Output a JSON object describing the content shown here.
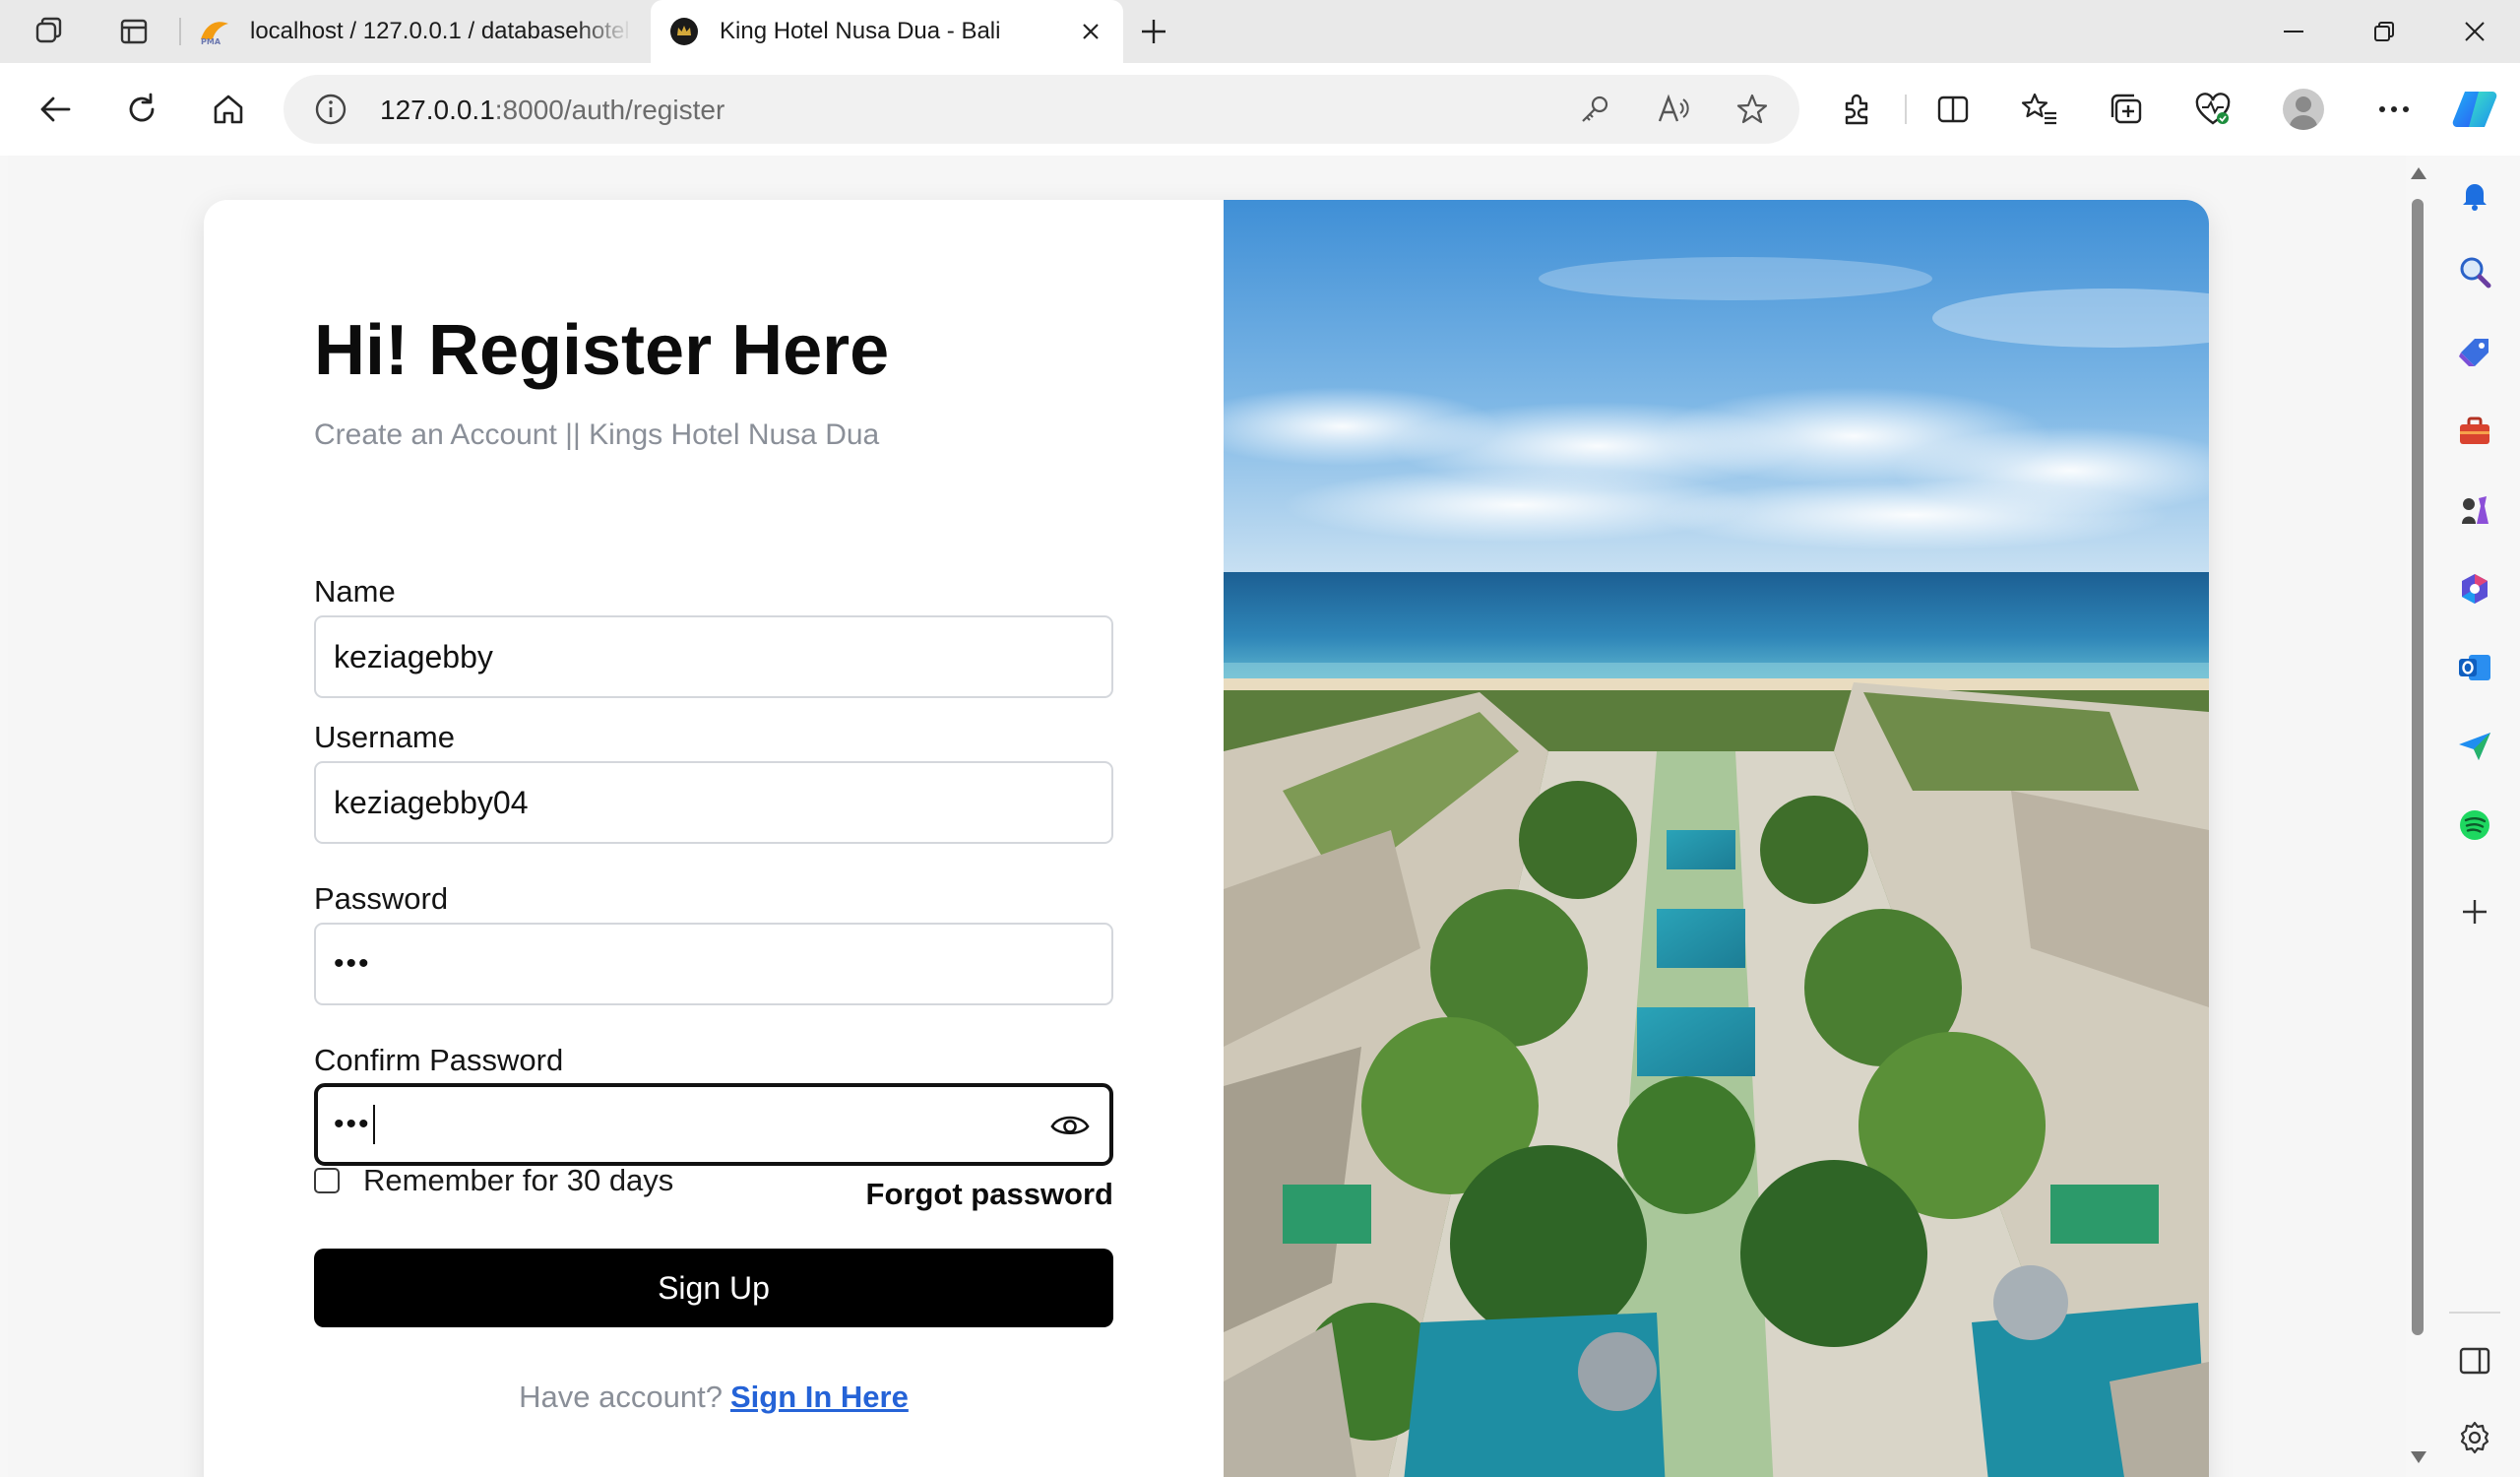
{
  "browser": {
    "tabs": [
      {
        "title": "localhost / 127.0.0.1 / databasehotel",
        "favicon": "phpmyadmin-icon",
        "active": false
      },
      {
        "title": "King Hotel Nusa Dua - Bali",
        "favicon": "crown-icon",
        "active": true
      }
    ],
    "url_host": "127.0.0.1",
    "url_rest": ":8000/auth/register"
  },
  "form": {
    "heading": "Hi! Register Here",
    "subheading": "Create an Account || Kings Hotel Nusa Dua",
    "fields": [
      {
        "label": "Name",
        "value": "keziagebby"
      },
      {
        "label": "Username",
        "value": "keziagebby04"
      },
      {
        "label": "Password",
        "value": "•••"
      },
      {
        "label": "Confirm Password",
        "value": "•••"
      }
    ],
    "remember_label": "Remember for 30 days",
    "remember_checked": false,
    "forgot_label": "Forgot password",
    "submit_label": "Sign Up",
    "footer_text": "Have account?",
    "footer_link": "Sign In Here"
  },
  "colors": {
    "accent_link": "#2563d7",
    "button_bg": "#000000",
    "muted_text": "#8a8f98"
  }
}
